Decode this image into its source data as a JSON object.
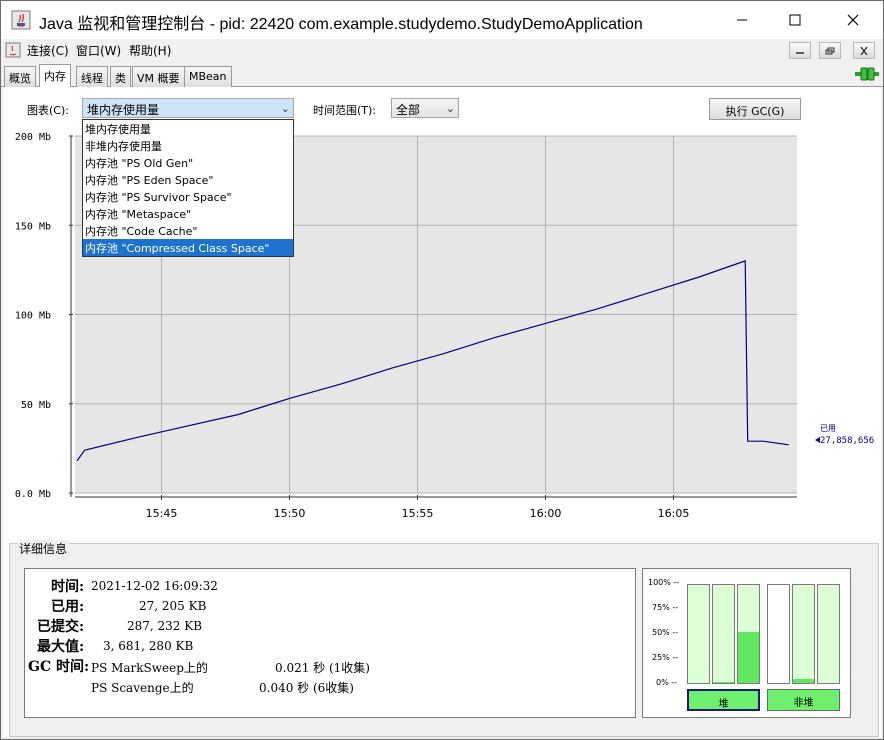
{
  "window": {
    "title": "Java 监视和管理控制台 - pid: 22420 com.example.studydemo.StudyDemoApplication"
  },
  "menu": [
    "连接(C)",
    "窗口(W)",
    "帮助(H)"
  ],
  "tabs": [
    "概览",
    "内存",
    "线程",
    "类",
    "VM 概要",
    "MBean"
  ],
  "active_tab": "内存",
  "toolbar": {
    "chart_label": "图表(C):",
    "chart_selected": "堆内存使用量",
    "range_label": "时间范围(T):",
    "range_selected": "全部",
    "gc_button": "执行 GC(G)"
  },
  "dropdown": {
    "options": [
      "堆内存使用量",
      "非堆内存使用量",
      "内存池 \"PS Old Gen\"",
      "内存池 \"PS Eden Space\"",
      "内存池 \"PS Survivor Space\"",
      "内存池 \"Metaspace\"",
      "内存池 \"Code Cache\"",
      "内存池 \"Compressed Class Space\""
    ],
    "highlighted": "内存池 \"Compressed Class Space\""
  },
  "chart_data": {
    "type": "line",
    "yticks": [
      "200 Mb",
      "150 Mb",
      "100 Mb",
      "50 Mb",
      "0.0 Mb"
    ],
    "xticks": [
      "15:45",
      "15:50",
      "15:55",
      "16:00",
      "16:05"
    ],
    "ylim": [
      0,
      200
    ],
    "series": [
      {
        "name": "已用",
        "points_time_mb": [
          [
            "15:41.7",
            18
          ],
          [
            "15:42.0",
            24
          ],
          [
            "15:44",
            31
          ],
          [
            "15:46",
            37.5
          ],
          [
            "15:48",
            44
          ],
          [
            "15:50",
            53
          ],
          [
            "15:52",
            61
          ],
          [
            "15:54",
            70
          ],
          [
            "15:56",
            78
          ],
          [
            "15:58",
            87
          ],
          [
            "16:00",
            95
          ],
          [
            "16:02",
            103
          ],
          [
            "16:04",
            112
          ],
          [
            "16:06",
            121
          ],
          [
            "16:07.8",
            130
          ],
          [
            "16:07.9",
            29
          ],
          [
            "16:08.5",
            29
          ],
          [
            "16:09.5",
            27
          ]
        ]
      }
    ],
    "legend_label": "已用",
    "current_value": "27,858,656",
    "color": "#000080"
  },
  "details": {
    "title": "详细信息",
    "time_label": "时间:",
    "time_value": "2021-12-02 16:09:32",
    "used_label": "已用:",
    "used_value": "27, 205 KB",
    "committed_label": "已提交:",
    "committed_value": "287, 232 KB",
    "max_label": "最大值:",
    "max_value": "3, 681, 280 KB",
    "gc_label": "GC 时间:",
    "gc1_name": "PS MarkSweep上的",
    "gc1_value": "0.021 秒 (1收集)",
    "gc2_name": "PS Scavenge上的",
    "gc2_value": "0.040 秒 (6收集)"
  },
  "bar_chart": {
    "ticks": [
      "100% --",
      "75% --",
      "50% --",
      "25% --",
      "0% --"
    ],
    "heap_bars": [
      0.0,
      0.01,
      0.52
    ],
    "nonheap_bars": [
      0.0,
      0.04,
      0.0
    ],
    "heap_label": "堆",
    "nonheap_label": "非堆"
  }
}
